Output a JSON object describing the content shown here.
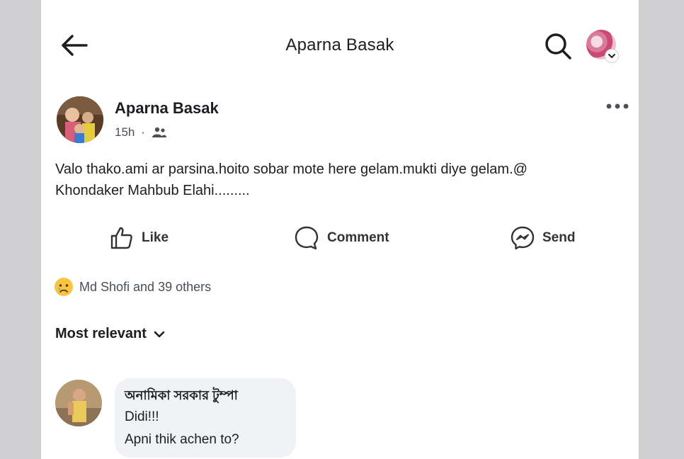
{
  "header": {
    "title": "Aparna Basak",
    "back_icon": "arrow-left-icon",
    "search_icon": "search-icon",
    "profile_icon": "profile-picture-icon"
  },
  "post": {
    "author": "Aparna Basak",
    "time": "15h",
    "separator": "·",
    "audience_icon": "friends-icon",
    "more_icon": "more-horizontal-icon",
    "text_line1": "Valo thako.ami ar parsina.hoito sobar mote here gelam.mukti diye gelam.@",
    "text_line2": "Khondaker Mahbub Elahi........."
  },
  "actions": {
    "like": "Like",
    "comment": "Comment",
    "send": "Send"
  },
  "reactions": {
    "icon": "sad-face-icon",
    "summary": "Md Shofi and 39 others"
  },
  "comments_sort": {
    "label": "Most relevant"
  },
  "comments": [
    {
      "name": "অনামিকা সরকার টুম্পা",
      "line1": "Didi!!!",
      "line2": "Apni thik achen to?"
    }
  ],
  "colors": {
    "text": "#1c1e21",
    "secondary_text": "#4b4f56",
    "bubble": "#f0f2f5",
    "page_bg": "#ffffff",
    "side_bg": "#cfcfd1"
  }
}
